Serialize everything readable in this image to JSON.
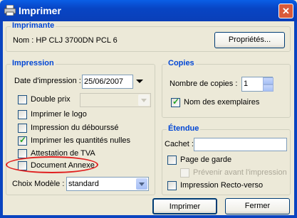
{
  "window": {
    "title": "Imprimer",
    "close_label": "✕"
  },
  "printer": {
    "section_title": "Imprimante",
    "name_label": "Nom : HP CLJ 3700DN PCL 6",
    "properties_button": "Propriétés..."
  },
  "impression": {
    "section_title": "Impression",
    "date_label": "Date d'impression :",
    "date_value": "25/06/2007",
    "double_prix_label": "Double prix",
    "options": [
      {
        "label": "Imprimer le logo",
        "checked": false
      },
      {
        "label": "Impression du débourssé",
        "checked": false
      },
      {
        "label": "Imprimer les quantités nulles",
        "checked": true
      },
      {
        "label": "Attestation de TVA",
        "checked": false
      },
      {
        "label": "Document Annexe",
        "checked": false
      }
    ],
    "model_label": "Choix Modèle :",
    "model_value": "standard"
  },
  "copies": {
    "section_title": "Copies",
    "count_label": "Nombre de copies :",
    "count_value": "1",
    "names_label": "Nom des exemplaires",
    "names_checked": true
  },
  "range": {
    "section_title": "Étendue",
    "cachet_label": "Cachet :",
    "page_garde_label": "Page de garde",
    "prevenir_label": "Prévenir avant l'impression",
    "recto_verso_label": "Impression Recto-verso"
  },
  "actions": {
    "print_button": "Imprimer",
    "close_button": "Fermer"
  },
  "colors": {
    "title_bar": "#0845c4",
    "section_title": "#0046d5",
    "annotation": "#e02020"
  }
}
